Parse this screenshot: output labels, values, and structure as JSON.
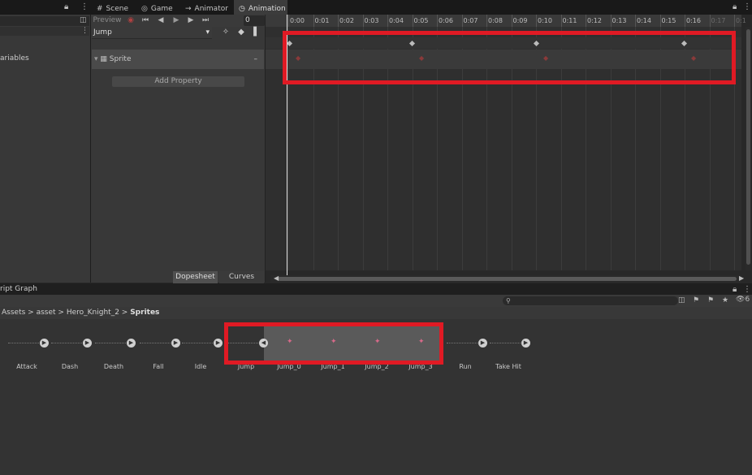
{
  "tabs": [
    {
      "label": "Scene",
      "icon": "grid-icon"
    },
    {
      "label": "Game",
      "icon": "gamepad-icon"
    },
    {
      "label": "Animator",
      "icon": "animator-icon"
    },
    {
      "label": "Animation",
      "icon": "clock-icon",
      "active": true
    }
  ],
  "left_panel": {
    "label": "ariables"
  },
  "anim_toolbar": {
    "preview_label": "Preview",
    "frame_value": "0"
  },
  "clip_selector": {
    "value": "Jump"
  },
  "properties": [
    {
      "label": "Sprite"
    }
  ],
  "add_property_label": "Add Property",
  "view_tabs": {
    "dopesheet": "Dopesheet",
    "curves": "Curves"
  },
  "ruler_ticks": [
    "0:00",
    "0:01",
    "0:02",
    "0:03",
    "0:04",
    "0:05",
    "0:06",
    "0:07",
    "0:08",
    "0:09",
    "0:10",
    "0:11",
    "0:12",
    "0:13",
    "0:14",
    "0:15",
    "0:16",
    "0:17",
    "0:1"
  ],
  "bottom_panel": {
    "title": "ript Graph",
    "hidden_count": "6"
  },
  "breadcrumb": {
    "items": [
      "Assets",
      "asset",
      "Hero_Knight_2"
    ],
    "current": "Sprites"
  },
  "clips": [
    "Attack",
    "Dash",
    "Death",
    "Fall",
    "Idle",
    "Jump",
    "Jump_0",
    "Jump_1",
    "Jump_2",
    "Jump_3",
    "Run",
    "Take Hit"
  ],
  "colors": {
    "highlight": "#e01a24",
    "background": "#282828",
    "accent_key": "#8a3a3a"
  }
}
